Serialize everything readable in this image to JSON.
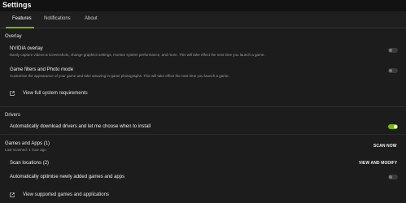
{
  "window": {
    "title": "Settings"
  },
  "tabs": [
    {
      "label": "Features",
      "active": true
    },
    {
      "label": "Notifications",
      "active": false
    },
    {
      "label": "About",
      "active": false
    }
  ],
  "overlay": {
    "heading": "Overlay",
    "nvidia_overlay": {
      "title": "NVIDIA overlay",
      "description": "Easily capture videos & screenshots, change graphics settings, monitor system performance, and more. This will take effect the next time you launch a game.",
      "enabled": false
    },
    "game_filters": {
      "title": "Game filters and Photo mode",
      "description": "Customise the appearance of your game and take amazing in-game photographs. This will take effect the next time you launch a game.",
      "enabled": false
    },
    "requirements_link": "View full system requirements"
  },
  "drivers": {
    "heading": "Drivers",
    "auto_download": {
      "title": "Automatically download drivers and let me choose when to install",
      "enabled": true
    }
  },
  "games": {
    "heading": "Games and Apps (1)",
    "last_scanned": "Last scanned: 1 hour ago",
    "scan_now": "SCAN NOW",
    "scan_locations": "Scan locations (2)",
    "view_modify": "VIEW AND MODIFY",
    "auto_optimise": {
      "title": "Automatically optimise newly added games and apps",
      "enabled": false
    },
    "supported_link": "View supported games and applications"
  },
  "colors": {
    "accent": "#76b900",
    "background": "#1c1c1c",
    "titlebar": "#121212"
  },
  "icons": {
    "external_link": "external-link-icon"
  }
}
